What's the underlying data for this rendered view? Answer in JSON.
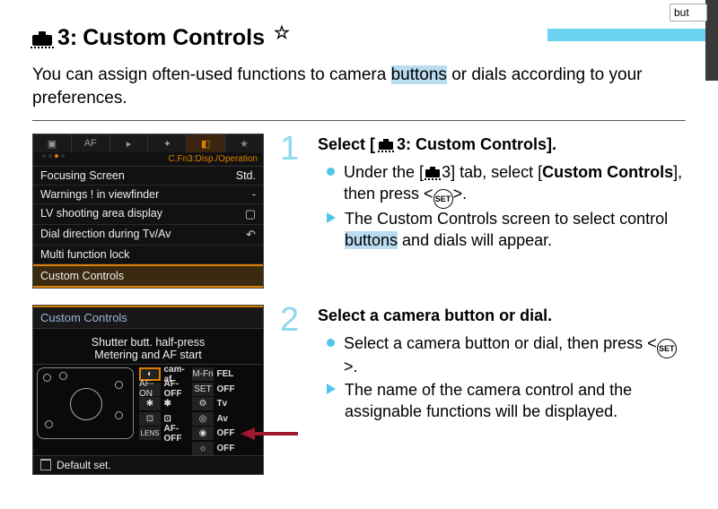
{
  "heading": {
    "number": "3:",
    "title": "Custom Controls"
  },
  "intro": {
    "pre": "You can assign often-used functions to camera ",
    "hl": "buttons",
    "post": " or dials according to your preferences."
  },
  "right_btn": "but",
  "menu1": {
    "tabs": [
      "camera",
      "AF",
      "play",
      "tool",
      "tool2",
      "star"
    ],
    "subhead": "C.Fn3:Disp./Operation",
    "rows": [
      {
        "label": "Focusing Screen",
        "val": "Std."
      },
      {
        "label": "Warnings ! in viewfinder",
        "val": "-"
      },
      {
        "label": "LV shooting area display",
        "val": "box"
      },
      {
        "label": "Dial direction during Tv/Av",
        "val": "swap"
      },
      {
        "label": "Multi function lock",
        "val": ""
      },
      {
        "label": "Custom Controls",
        "val": "",
        "sel": true
      }
    ]
  },
  "menu2": {
    "head": "Custom Controls",
    "sub1": "Shutter butt. half-press",
    "sub2": "Metering and AF start",
    "cells": [
      [
        "eye",
        "cam-af",
        "mfn",
        "FEL"
      ],
      [
        "afon",
        "AF-OFF",
        "set",
        "OFF"
      ],
      [
        "star",
        "star",
        "dial1",
        "Tv"
      ],
      [
        "dot",
        "dot",
        "dial2",
        "Av"
      ],
      [
        "lens",
        "AF-OFF",
        "ring",
        "OFF"
      ],
      [
        "",
        "",
        "light",
        "OFF"
      ]
    ],
    "foot": "Default set."
  },
  "steps": [
    {
      "title_pre": "Select [",
      "title_mid": "3: Custom Controls].",
      "b1_pre": "Under the [",
      "b1_mid": "3",
      "b1_post": "] tab, select [",
      "b1_bold": "Custom Controls",
      "b1_end": "], then press <",
      "b1_set": "SET",
      "b1_close": ">.",
      "b2_pre": "The Custom Controls screen to select control ",
      "b2_hl": "buttons",
      "b2_post": " and dials will appear."
    },
    {
      "title": "Select a camera button or dial.",
      "b1_pre": "Select a camera button or dial, then press <",
      "b1_set": "SET",
      "b1_close": ">.",
      "b2": "The name of the camera control and the assignable functions will be displayed."
    }
  ]
}
